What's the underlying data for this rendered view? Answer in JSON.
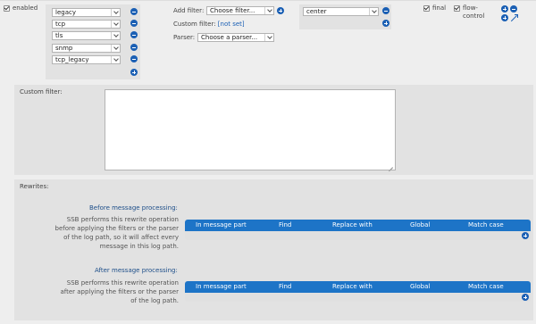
{
  "enabled": {
    "label": "enabled",
    "checked": true
  },
  "sources": [
    "legacy",
    "tcp",
    "tls",
    "snmp",
    "tcp_legacy"
  ],
  "filter": {
    "add_filter_label": "Add filter:",
    "add_filter_value": "Choose filter...",
    "custom_filter_label": "Custom filter:",
    "custom_filter_value": "[not set]",
    "parser_label": "Parser:",
    "parser_value": "Choose a parser..."
  },
  "destination": {
    "value": "center"
  },
  "flags": {
    "final": {
      "label": "final",
      "checked": true
    },
    "flow_control": {
      "label": "flow-control",
      "checked": true
    }
  },
  "custom_filter_area": {
    "label": "Custom filter:",
    "value": ""
  },
  "rewrites": {
    "label": "Rewrites:",
    "before": {
      "title": "Before message processing:",
      "description": "SSB performs this rewrite operation before applying the filters or the parser of the log path, so it will affect every message in this log path."
    },
    "after": {
      "title": "After message processing:",
      "description": "SSB performs this rewrite operation after applying the filters or the parser of the log path."
    },
    "columns": [
      "In message part",
      "Find",
      "Replace with",
      "Global",
      "Match case"
    ]
  },
  "colors": {
    "accent": "#1a5fb4",
    "table_header": "#1d74c7",
    "section_title": "#1d4e89"
  }
}
